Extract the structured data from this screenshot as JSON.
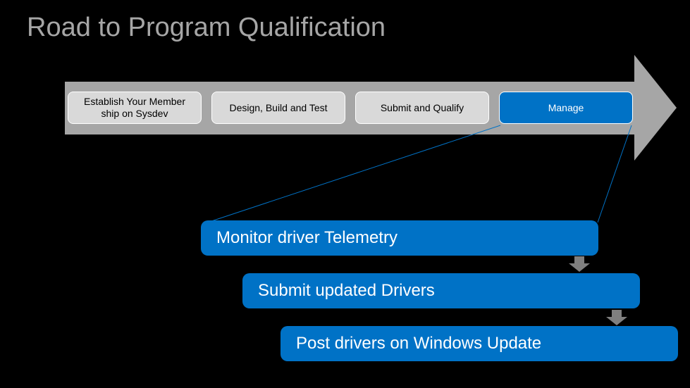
{
  "title": "Road to Program Qualification",
  "stages": [
    {
      "label": "Establish Your Member ship on Sysdev",
      "type": "grey"
    },
    {
      "label": "Design, Build and Test",
      "type": "grey"
    },
    {
      "label": "Submit and Qualify",
      "type": "grey"
    },
    {
      "label": "Manage",
      "type": "blue"
    }
  ],
  "details": [
    {
      "label": "Monitor driver Telemetry"
    },
    {
      "label": "Submit updated Drivers"
    },
    {
      "label": "Post drivers on Windows Update"
    }
  ],
  "colors": {
    "accent_blue": "#0072c6",
    "neutral_grey": "#a6a6a6",
    "box_grey": "#d9d9d9",
    "arrow_grey": "#7f7f7f"
  }
}
